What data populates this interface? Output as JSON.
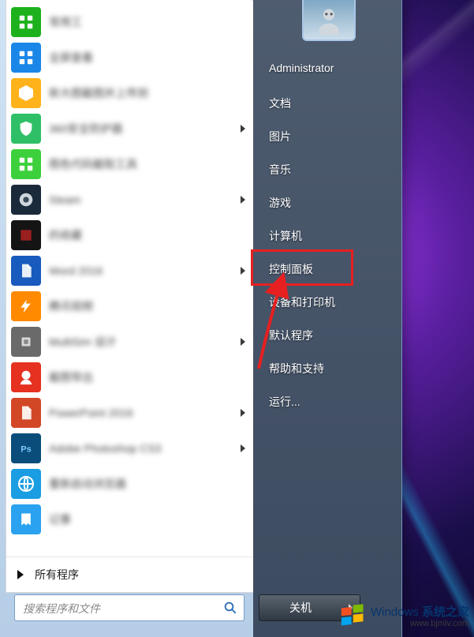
{
  "programs": [
    {
      "label": "常用工",
      "has_sub": false,
      "icon_bg": "#1db11d",
      "icon_glyph": "grid",
      "blur": true
    },
    {
      "label": "全屏查看",
      "has_sub": false,
      "icon_bg": "#1a86e8",
      "icon_glyph": "grid",
      "blur": true
    },
    {
      "label": "新大图截图并上传到",
      "has_sub": false,
      "icon_bg": "#ffb21a",
      "icon_glyph": "hex",
      "blur": true
    },
    {
      "label": "360安全防护器",
      "has_sub": true,
      "icon_bg": "#2fc067",
      "icon_glyph": "shield",
      "blur": true
    },
    {
      "label": "图色代码截取工具",
      "has_sub": false,
      "icon_bg": "#3cd13c",
      "icon_glyph": "grid",
      "blur": true
    },
    {
      "label": "Steam",
      "has_sub": true,
      "icon_bg": "#1a2a3a",
      "icon_glyph": "circle",
      "blur": true
    },
    {
      "label": "的收藏",
      "has_sub": false,
      "icon_bg": "#141414",
      "icon_glyph": "square",
      "blur": true
    },
    {
      "label": "Word 2016",
      "has_sub": true,
      "icon_bg": "#185abd",
      "icon_glyph": "doc",
      "blur": true
    },
    {
      "label": "腾讯视频",
      "has_sub": false,
      "icon_bg": "#ff8a00",
      "icon_glyph": "bolt",
      "blur": true
    },
    {
      "label": "MultiSim 设计",
      "has_sub": true,
      "icon_bg": "#6a6a6a",
      "icon_glyph": "chip",
      "blur": true
    },
    {
      "label": "截图导出",
      "has_sub": false,
      "icon_bg": "#e63020",
      "icon_glyph": "face",
      "blur": true
    },
    {
      "label": "PowerPoint 2016",
      "has_sub": true,
      "icon_bg": "#d24726",
      "icon_glyph": "doc",
      "blur": true
    },
    {
      "label": "Adobe Photoshop CS3",
      "has_sub": true,
      "icon_bg": "#0a4d7a",
      "icon_glyph": "ps",
      "blur": true
    },
    {
      "label": "重新启动浏览器",
      "has_sub": false,
      "icon_bg": "#1a9de2",
      "icon_glyph": "globe",
      "blur": true
    },
    {
      "label": "记事",
      "has_sub": false,
      "icon_bg": "#2aa2ef",
      "icon_glyph": "note",
      "blur": true
    }
  ],
  "all_programs_label": "所有程序",
  "search_placeholder": "搜索程序和文件",
  "right_items": [
    "Administrator",
    "文档",
    "图片",
    "音乐",
    "游戏",
    "计算机",
    "控制面板",
    "设备和打印机",
    "默认程序",
    "帮助和支持",
    "运行..."
  ],
  "highlight_index": 6,
  "shutdown_label": "关机",
  "watermark_brand": "Windows",
  "watermark_suffix": "系统之家",
  "watermark_url": "www.bjmlv.com"
}
